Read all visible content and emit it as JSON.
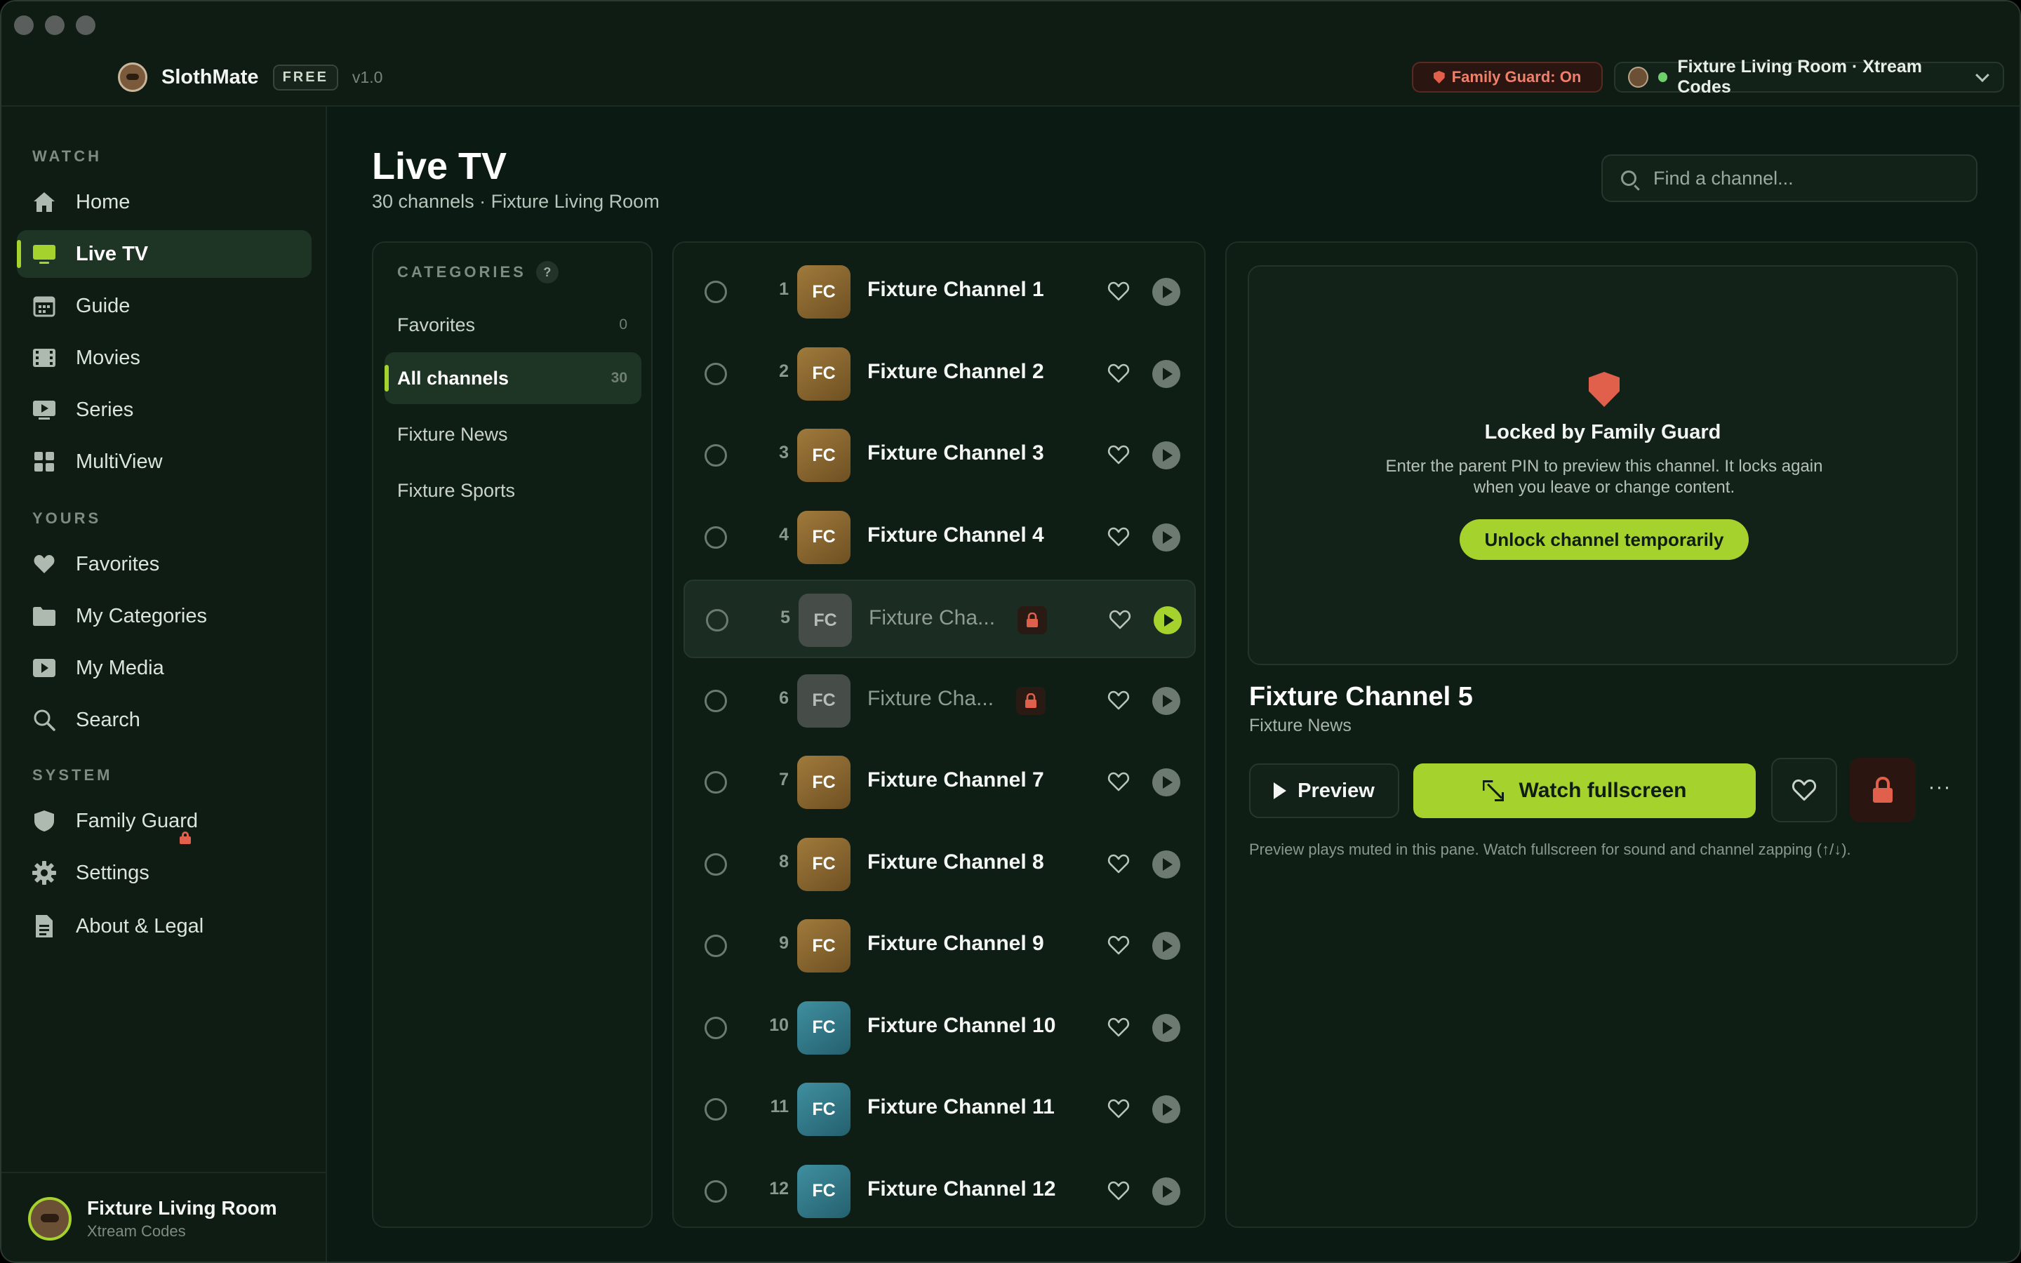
{
  "app": {
    "name": "SlothMate",
    "plan_badge": "FREE",
    "version": "v1.0",
    "family_guard_status": "Family Guard: On",
    "source_label": "Fixture Living Room · Xtream Codes"
  },
  "colors": {
    "accent": "#a6d22e",
    "background": "#0b1a12",
    "panel": "#0f1e15",
    "danger": "#e0604c"
  },
  "sidebar": {
    "sections": [
      {
        "label": "WATCH"
      },
      {
        "label": "YOURS"
      },
      {
        "label": "SYSTEM"
      }
    ],
    "items": [
      {
        "label": "Home",
        "icon": "home-icon"
      },
      {
        "label": "Live TV",
        "icon": "tv-icon",
        "active": true
      },
      {
        "label": "Guide",
        "icon": "calendar-icon"
      },
      {
        "label": "Movies",
        "icon": "film-icon"
      },
      {
        "label": "Series",
        "icon": "play-screen-icon"
      },
      {
        "label": "MultiView",
        "icon": "grid-icon"
      },
      {
        "label": "Favorites",
        "icon": "heart-icon"
      },
      {
        "label": "My Categories",
        "icon": "folder-icon"
      },
      {
        "label": "My Media",
        "icon": "media-icon"
      },
      {
        "label": "Search",
        "icon": "search-icon"
      },
      {
        "label": "Family Guard",
        "icon": "shield-icon",
        "locked": true
      },
      {
        "label": "Settings",
        "icon": "gear-icon"
      },
      {
        "label": "About & Legal",
        "icon": "document-icon"
      }
    ],
    "profile": {
      "name": "Fixture Living Room",
      "subtitle": "Xtream Codes"
    }
  },
  "main": {
    "title": "Live TV",
    "subtitle": "30 channels · Fixture Living Room",
    "search_placeholder": "Find a channel..."
  },
  "categories": {
    "header": "CATEGORIES",
    "help": "?",
    "items": [
      {
        "label": "Favorites",
        "count": "0"
      },
      {
        "label": "All channels",
        "count": "30",
        "active": true
      },
      {
        "label": "Fixture News",
        "count": ""
      },
      {
        "label": "Fixture Sports",
        "count": ""
      }
    ]
  },
  "channels": [
    {
      "num": "1",
      "logo": "FC",
      "name": "Fixture Channel 1",
      "locked": false,
      "tone": "gold"
    },
    {
      "num": "2",
      "logo": "FC",
      "name": "Fixture Channel 2",
      "locked": false,
      "tone": "gold"
    },
    {
      "num": "3",
      "logo": "FC",
      "name": "Fixture Channel 3",
      "locked": false,
      "tone": "gold"
    },
    {
      "num": "4",
      "logo": "FC",
      "name": "Fixture Channel 4",
      "locked": false,
      "tone": "gold"
    },
    {
      "num": "5",
      "logo": "FC",
      "name": "Fixture Cha...",
      "locked": true,
      "selected": true,
      "tone": "gray"
    },
    {
      "num": "6",
      "logo": "FC",
      "name": "Fixture Cha...",
      "locked": true,
      "tone": "gray"
    },
    {
      "num": "7",
      "logo": "FC",
      "name": "Fixture Channel 7",
      "locked": false,
      "tone": "gold"
    },
    {
      "num": "8",
      "logo": "FC",
      "name": "Fixture Channel 8",
      "locked": false,
      "tone": "gold"
    },
    {
      "num": "9",
      "logo": "FC",
      "name": "Fixture Channel 9",
      "locked": false,
      "tone": "gold"
    },
    {
      "num": "10",
      "logo": "FC",
      "name": "Fixture Channel 10",
      "locked": false,
      "tone": "teal"
    },
    {
      "num": "11",
      "logo": "FC",
      "name": "Fixture Channel 11",
      "locked": false,
      "tone": "teal"
    },
    {
      "num": "12",
      "logo": "FC",
      "name": "Fixture Channel 12",
      "locked": false,
      "tone": "teal"
    }
  ],
  "preview": {
    "locked_title": "Locked by Family Guard",
    "locked_desc": "Enter the parent PIN to preview this channel. It locks again when you leave or change content.",
    "unlock_label": "Unlock channel temporarily",
    "channel_name": "Fixture Channel 5",
    "channel_category": "Fixture News",
    "preview_label": "Preview",
    "watch_label": "Watch fullscreen",
    "more_label": "···",
    "hint": "Preview plays muted in this pane. Watch fullscreen for sound and channel zapping (↑/↓)."
  }
}
